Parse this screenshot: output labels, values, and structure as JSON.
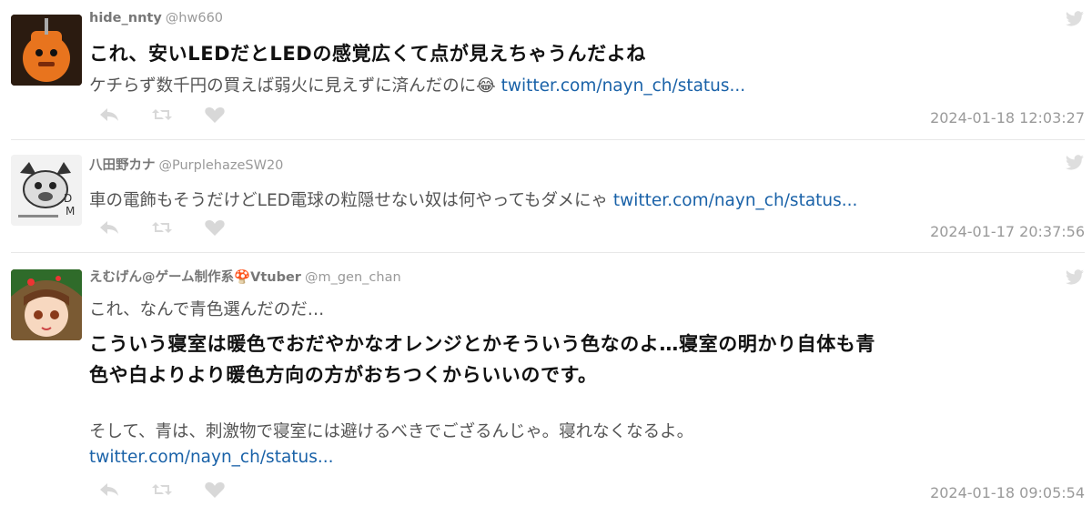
{
  "tweets": [
    {
      "name": "hide_nnty",
      "handle": "@hw660",
      "bold_line": "これ、安いLEDだとLEDの感覚広くて点が見えちゃうんだよね",
      "text_line": "ケチらず数千円の買えば弱火に見えずに済んだのに😂",
      "link": "twitter.com/nayn_ch/status...",
      "timestamp": "2024-01-18 12:03:27"
    },
    {
      "name": "八田野カナ",
      "handle": "@PurplehazeSW20",
      "text_line": "車の電飾もそうだけどLED電球の粒隠せない奴は何やってもダメにゃ",
      "link": "twitter.com/nayn_ch/status...",
      "timestamp": "2024-01-17 20:37:56"
    },
    {
      "name": "えむげん@ゲーム制作系🍄Vtuber",
      "handle": "@m_gen_chan",
      "text_line_1": "これ、なんで青色選んだのだ…",
      "bold_line_1": "こういう寝室は暖色でおだやかなオレンジとかそういう色なのよ…寝室の明かり自体も青",
      "bold_line_2": "色や白よりより暖色方向の方がおちつくからいいのです。",
      "text_line_2": "そして、青は、刺激物で寝室には避けるべきでござるんじゃ。寝れなくなるよ。",
      "link": "twitter.com/nayn_ch/status...",
      "timestamp": "2024-01-18 09:05:54"
    }
  ],
  "icons": [
    "twitter-bird-icon",
    "reply-icon",
    "retweet-icon",
    "like-icon"
  ],
  "colors": {
    "link": "#1a62a8",
    "muted": "#999999",
    "action_icon": "#d8d8d8"
  }
}
